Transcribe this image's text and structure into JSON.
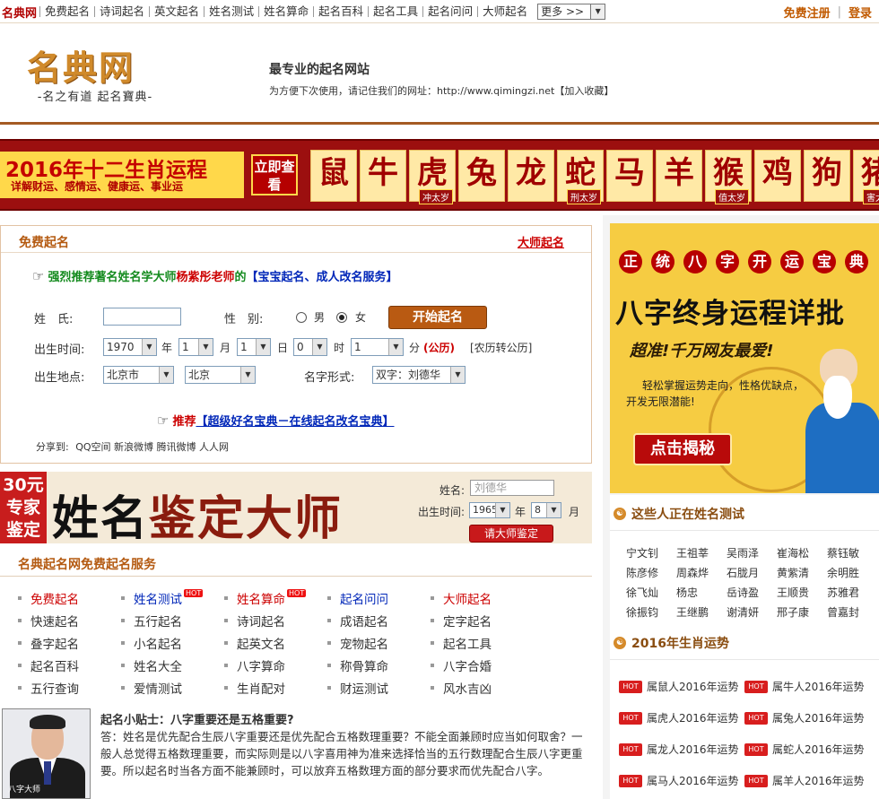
{
  "topbar": {
    "brand": "名典网",
    "nav": [
      "免费起名",
      "诗词起名",
      "英文起名",
      "姓名测试",
      "姓名算命",
      "起名百科",
      "起名工具",
      "起名问问",
      "大师起名"
    ],
    "more_select": "更多 >>",
    "register": "免费注册",
    "login": "登录"
  },
  "header": {
    "logo_text": "名典网",
    "logo_sub": "-名之有道 起名寶典-",
    "tagline": "最专业的起名网站",
    "bookmark_text": "为方便下次使用，请记住我们的网址：http://www.qimingzi.net【加入收藏】"
  },
  "banner": {
    "title": "2016年十二生肖运程",
    "subtitle": "详解财运、感情运、健康运、事业运",
    "cta": "立即查看",
    "zodiac": [
      {
        "char": "鼠",
        "tag": ""
      },
      {
        "char": "牛",
        "tag": ""
      },
      {
        "char": "虎",
        "tag": "冲太岁"
      },
      {
        "char": "兔",
        "tag": ""
      },
      {
        "char": "龙",
        "tag": ""
      },
      {
        "char": "蛇",
        "tag": "刑太岁"
      },
      {
        "char": "马",
        "tag": ""
      },
      {
        "char": "羊",
        "tag": ""
      },
      {
        "char": "猴",
        "tag": "值太岁"
      },
      {
        "char": "鸡",
        "tag": ""
      },
      {
        "char": "狗",
        "tag": ""
      },
      {
        "char": "猪",
        "tag": "害太岁"
      }
    ]
  },
  "free_naming": {
    "title": "免费起名",
    "master_link": "大师起名",
    "recommend1": {
      "prefix": "强烈推荐著名姓名学大师",
      "name": "杨紫彤老师",
      "de": "的",
      "service": "【宝宝起名、成人改名服务】"
    },
    "surname_label": "姓　氏:",
    "gender_label": "性　别:",
    "male": "男",
    "female": "女",
    "gender_selected": "女",
    "start_button": "开始起名",
    "birth_time_label": "出生时间:",
    "year": "1970",
    "year_unit": "年",
    "month": "1",
    "month_unit": "月",
    "day": "1",
    "day_unit": "日",
    "hour": "0",
    "hour_unit": "时",
    "minute": "1",
    "minute_unit": "分",
    "solar": "(公历)",
    "lunar_link": "[农历转公历]",
    "birthplace_label": "出生地点:",
    "province": "北京市",
    "city": "北京",
    "name_form_label": "名字形式:",
    "name_form": "双字：刘德华",
    "recommend2": {
      "prefix": "推荐",
      "link": "【超级好名宝典－在线起名改名宝典】"
    },
    "share_label": "分享到:",
    "share_targets": [
      "QQ空间",
      "新浪微博",
      "腾讯微博",
      "人人网"
    ]
  },
  "master_banner": {
    "badge": "30元专家鉴定",
    "title_a": "姓名",
    "title_b": "鉴定大师",
    "name_label": "姓名:",
    "name_placeholder": "刘德华",
    "birth_label": "出生时间:",
    "year": "1965",
    "year_unit": "年",
    "month": "8",
    "month_unit": "月",
    "button": "请大师鉴定"
  },
  "services": {
    "title": "名典起名网免费起名服务",
    "items": [
      {
        "label": "免费起名",
        "style": "red",
        "hot": false
      },
      {
        "label": "姓名测试",
        "style": "blue",
        "hot": true
      },
      {
        "label": "姓名算命",
        "style": "red",
        "hot": true
      },
      {
        "label": "起名问问",
        "style": "blue",
        "hot": false
      },
      {
        "label": "大师起名",
        "style": "red",
        "hot": false
      },
      {
        "label": "快速起名",
        "style": "",
        "hot": false
      },
      {
        "label": "五行起名",
        "style": "",
        "hot": false
      },
      {
        "label": "诗词起名",
        "style": "",
        "hot": false
      },
      {
        "label": "成语起名",
        "style": "",
        "hot": false
      },
      {
        "label": "定字起名",
        "style": "",
        "hot": false
      },
      {
        "label": "叠字起名",
        "style": "",
        "hot": false
      },
      {
        "label": "小名起名",
        "style": "",
        "hot": false
      },
      {
        "label": "起英文名",
        "style": "",
        "hot": false
      },
      {
        "label": "宠物起名",
        "style": "",
        "hot": false
      },
      {
        "label": "起名工具",
        "style": "",
        "hot": false
      },
      {
        "label": "起名百科",
        "style": "",
        "hot": false
      },
      {
        "label": "姓名大全",
        "style": "",
        "hot": false
      },
      {
        "label": "八字算命",
        "style": "",
        "hot": false
      },
      {
        "label": "称骨算命",
        "style": "",
        "hot": false
      },
      {
        "label": "八字合婚",
        "style": "",
        "hot": false
      },
      {
        "label": "五行查询",
        "style": "",
        "hot": false
      },
      {
        "label": "爱情测试",
        "style": "",
        "hot": false
      },
      {
        "label": "生肖配对",
        "style": "",
        "hot": false
      },
      {
        "label": "财运测试",
        "style": "",
        "hot": false
      },
      {
        "label": "风水吉凶",
        "style": "",
        "hot": false
      }
    ],
    "hot_label": "HOT"
  },
  "tip": {
    "photo_caption": "八字大师",
    "title": "起名小贴士：八字重要还是五格重要?",
    "body": "答：姓名是优先配合生辰八字重要还是优先配合五格数理重要？不能全面兼顾时应当如何取舍？一般人总觉得五格数理重要，而实际则是以八字喜用神为准来选择恰当的五行数理配合生辰八字更重要。所以起名时当各方面不能兼顾时，可以放弃五格数理方面的部分要求而优先配合八字。"
  },
  "side_ad": {
    "title_chars": [
      "正",
      "统",
      "八",
      "字",
      "开",
      "运",
      "宝",
      "典"
    ],
    "headline": "八字终身运程详批",
    "slogan": "超准!千万网友最爱!",
    "line1": "轻松掌握运势走向，性格优缺点，",
    "line2": "开发无限潜能!",
    "button": "点击揭秘"
  },
  "testing_now": {
    "title": "这些人正在姓名测试",
    "names": [
      "宁文钊",
      "王祖莘",
      "吴雨泽",
      "崔海松",
      "蔡钰敏",
      "陈彦修",
      "周森烨",
      "石胧月",
      "黄紫清",
      "余明胜",
      "徐飞灿",
      "杨忠",
      "岳诗盈",
      "王顺贵",
      "苏雅君",
      "徐振钧",
      "王继鹏",
      "谢清妍",
      "邢子康",
      "曾嘉封"
    ]
  },
  "zodiac_luck": {
    "title": "2016年生肖运势",
    "hot_label": "HOT",
    "items": [
      "属鼠人2016年运势",
      "属牛人2016年运势",
      "属虎人2016年运势",
      "属兔人2016年运势",
      "属龙人2016年运势",
      "属蛇人2016年运势",
      "属马人2016年运势",
      "属羊人2016年运势"
    ]
  },
  "colors": {
    "brand_red": "#b10000",
    "accent_brown": "#b45a11",
    "banner_red": "#9c0f0f",
    "link_blue": "#0026b8"
  }
}
